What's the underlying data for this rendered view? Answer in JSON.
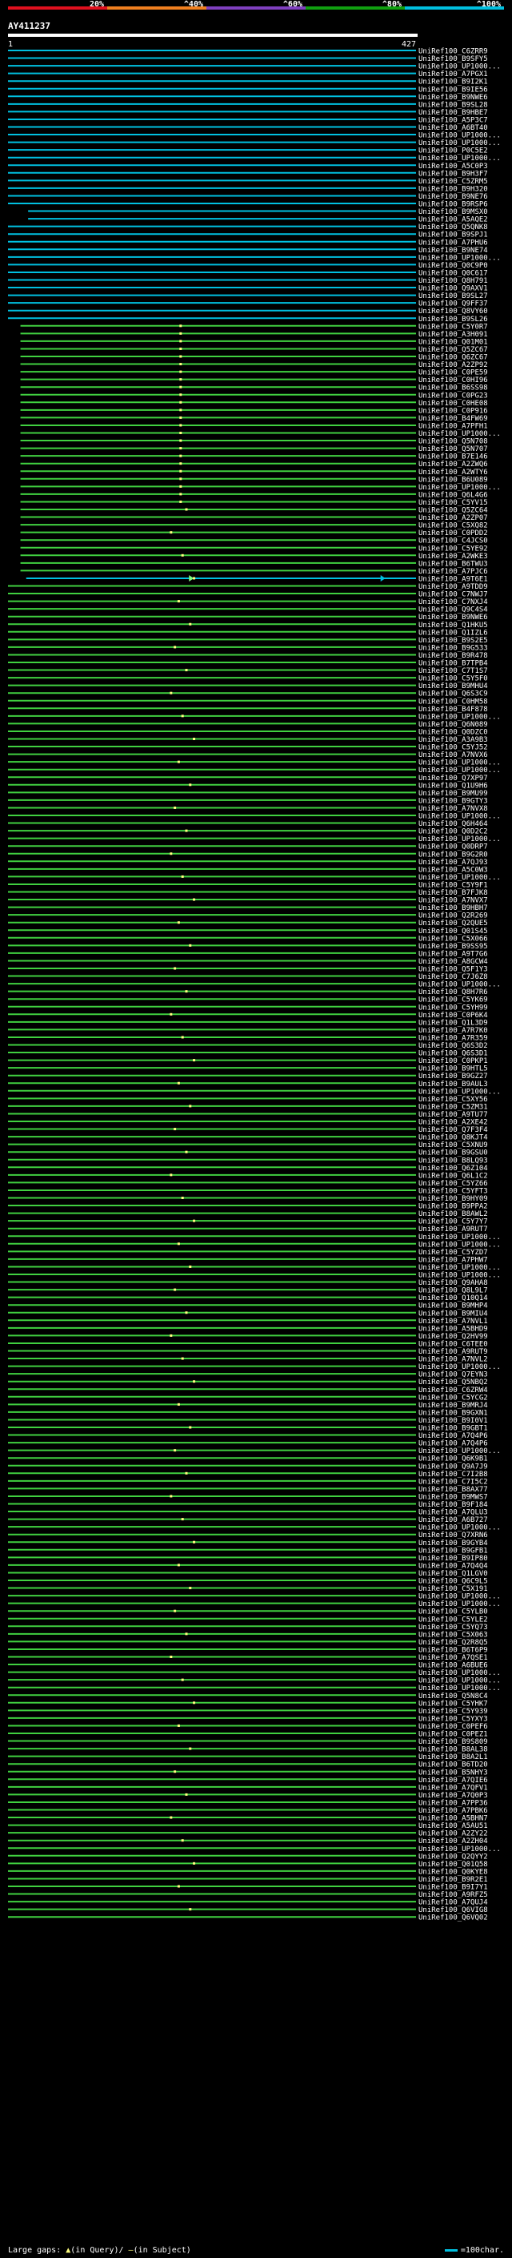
{
  "query": "AY411237",
  "legend": {
    "labels": [
      "20%",
      "^40%",
      "^60%",
      "^80%",
      "^100%"
    ],
    "colors": [
      "#e0101e",
      "#f08020",
      "#8040c0",
      "#10a010",
      "#00c0e0"
    ]
  },
  "footer": {
    "left_prefix": "Large gaps: ",
    "left_middle": "(in Query)/ ",
    "left_suffix": "(in Subject)",
    "right_text": "=100char."
  },
  "chart_data": {
    "type": "alignment-overview",
    "query_length": 427,
    "ruler": {
      "start": 1,
      "end": 427
    },
    "identity_colors": {
      "lt20": "#e0101e",
      "20_40": "#f08020",
      "40_60": "#c020c0",
      "60_80": "#40d040",
      "80_100": "#00c0e0"
    },
    "subjects": [
      "UniRef100_C6ZRR9",
      "UniRef100_B9SFY5",
      "UniRef100_UP1000...",
      "UniRef100_A7PGX1",
      "UniRef100_B9I2K1",
      "UniRef100_B9IE56",
      "UniRef100_B9NWE6",
      "UniRef100_B9SL28",
      "UniRef100_B9HBE7",
      "UniRef100_A5P3C7",
      "UniRef100_A6BT40",
      "UniRef100_UP1000...",
      "UniRef100_UP1000...",
      "UniRef100_P0C5E2",
      "UniRef100_UP1000...",
      "UniRef100_A5C0P3",
      "UniRef100_B9H3F7",
      "UniRef100_C5ZRM5",
      "UniRef100_B9H320",
      "UniRef100_B9NE76",
      "UniRef100_B9RSP6",
      "UniRef100_B9MSX0",
      "UniRef100_A5AQE2",
      "UniRef100_Q5QNK8",
      "UniRef100_B9SPJ1",
      "UniRef100_A7PHU6",
      "UniRef100_B9NE74",
      "UniRef100_UP1000...",
      "UniRef100_Q0C9P0",
      "UniRef100_Q0C617",
      "UniRef100_Q8H791",
      "UniRef100_Q9AXV1",
      "UniRef100_B9SL27",
      "UniRef100_Q9FF37",
      "UniRef100_Q8VY60",
      "UniRef100_B9SL26",
      "UniRef100_C5Y0R7",
      "UniRef100_A3H091",
      "UniRef100_Q01M01",
      "UniRef100_Q5ZC67",
      "UniRef100_Q6ZC67",
      "UniRef100_A2ZP92",
      "UniRef100_C0PE59",
      "UniRef100_C0HI96",
      "UniRef100_B6SS98",
      "UniRef100_C0PG23",
      "UniRef100_C0HE08",
      "UniRef100_C0P916",
      "UniRef100_B4FW69",
      "UniRef100_A7PFH1",
      "UniRef100_UP1000...",
      "UniRef100_Q5N708",
      "UniRef100_Q5N707",
      "UniRef100_B7E146",
      "UniRef100_A2ZWQ6",
      "UniRef100_A2WTY6",
      "UniRef100_B6U089",
      "UniRef100_UP1000...",
      "UniRef100_Q6L4G6",
      "UniRef100_C5YV15",
      "UniRef100_Q5ZC64",
      "UniRef100_A2ZP07",
      "UniRef100_C5XQ82",
      "UniRef100_C0PDD2",
      "UniRef100_C4JCS0",
      "UniRef100_C5YE92",
      "UniRef100_A2WKE3",
      "UniRef100_B6TWU3",
      "UniRef100_A7PJC6",
      "UniRef100_A9T6E1",
      "UniRef100_A9TDD9",
      "UniRef100_C7NWJ7",
      "UniRef100_C7NXJ4",
      "UniRef100_Q9C4S4",
      "UniRef100_B9NWE6",
      "UniRef100_Q1HKU5",
      "UniRef100_Q1IZL6",
      "UniRef100_B9S2E5",
      "UniRef100_B9G533",
      "UniRef100_B9R478",
      "UniRef100_B7TPB4",
      "UniRef100_C7T1S7",
      "UniRef100_C5Y5F0",
      "UniRef100_B9MHU4",
      "UniRef100_Q6S3C9",
      "UniRef100_C0HM58",
      "UniRef100_B4F878",
      "UniRef100_UP1000...",
      "UniRef100_Q6N089",
      "UniRef100_Q0DZC0",
      "UniRef100_A3A9B3",
      "UniRef100_C5YJ52",
      "UniRef100_A7NVX6",
      "UniRef100_UP1000...",
      "UniRef100_UP1000...",
      "UniRef100_Q7XP97",
      "UniRef100_Q1U9H6",
      "UniRef100_B9MU99",
      "UniRef100_B9GTY3",
      "UniRef100_A7NVX8",
      "UniRef100_UP1000...",
      "UniRef100_Q6H464",
      "UniRef100_Q0D2C2",
      "UniRef100_UP1000...",
      "UniRef100_Q0DRP7",
      "UniRef100_B9G2R0",
      "UniRef100_A7QJ93",
      "UniRef100_A5C0W3",
      "UniRef100_UP1000...",
      "UniRef100_C5Y9F1",
      "UniRef100_B7FJK8",
      "UniRef100_A7NVX7",
      "UniRef100_B9HBH7",
      "UniRef100_Q2R269",
      "UniRef100_Q2QUE5",
      "UniRef100_Q01S45",
      "UniRef100_C5X066",
      "UniRef100_B9SS95",
      "UniRef100_A9T7G6",
      "UniRef100_A8GCW4",
      "UniRef100_Q5F1Y3",
      "UniRef100_C7J6Z8",
      "UniRef100_UP1000...",
      "UniRef100_Q8H7R6",
      "UniRef100_C5YK69",
      "UniRef100_C5YH99",
      "UniRef100_C0P6K4",
      "UniRef100_Q1L3D9",
      "UniRef100_A7R7K0",
      "UniRef100_A7R359",
      "UniRef100_Q6S3D2",
      "UniRef100_Q6S3D1",
      "UniRef100_C0PKP1",
      "UniRef100_B9HTL5",
      "UniRef100_B9GZ27",
      "UniRef100_B9AUL3",
      "UniRef100_UP1000...",
      "UniRef100_C5XY56",
      "UniRef100_C5ZM31",
      "UniRef100_A9TU77",
      "UniRef100_A2XE42",
      "UniRef100_Q7F3F4",
      "UniRef100_Q8KJT4",
      "UniRef100_C5XNU9",
      "UniRef100_B9GSU0",
      "UniRef100_B8LQ93",
      "UniRef100_Q6Z104",
      "UniRef100_Q6L1C2",
      "UniRef100_C5YZ66",
      "UniRef100_C5YFT3",
      "UniRef100_B9HY09",
      "UniRef100_B9PPA2",
      "UniRef100_B8AWL2",
      "UniRef100_C5Y7Y7",
      "UniRef100_A9RUT7",
      "UniRef100_UP1000...",
      "UniRef100_UP1000...",
      "UniRef100_C5YZD7",
      "UniRef100_A7PHW7",
      "UniRef100_UP1000...",
      "UniRef100_UP1000...",
      "UniRef100_Q9AHA8",
      "UniRef100_Q8L9L7",
      "UniRef100_Q10Q14",
      "UniRef100_B9MHP4",
      "UniRef100_B9MIU4",
      "UniRef100_A7NVL1",
      "UniRef100_A5BHD9",
      "UniRef100_Q2HV99",
      "UniRef100_C6TEE0",
      "UniRef100_A9RUT9",
      "UniRef100_A7NVL2",
      "UniRef100_UP1000...",
      "UniRef100_Q7EYN3",
      "UniRef100_Q5NBQ2",
      "UniRef100_C6ZRW4",
      "UniRef100_C5YCG2",
      "UniRef100_B9MRJ4",
      "UniRef100_B9GXN1",
      "UniRef100_B9I0V1",
      "UniRef100_B9GBT1",
      "UniRef100_A7Q4P6",
      "UniRef100_A7Q4P6",
      "UniRef100_UP1000...",
      "UniRef100_Q6K9B1",
      "UniRef100_Q9A7J9",
      "UniRef100_C7I2B8",
      "UniRef100_C7I5C2",
      "UniRef100_B8AX77",
      "UniRef100_B9MWS7",
      "UniRef100_B9F184",
      "UniRef100_A7QLU3",
      "UniRef100_A6B727",
      "UniRef100_UP1000...",
      "UniRef100_Q7XRN6",
      "UniRef100_B9GYB4",
      "UniRef100_B9GFB1",
      "UniRef100_B9IP80",
      "UniRef100_A7Q4Q4",
      "UniRef100_Q1LGV0",
      "UniRef100_Q6C9L5",
      "UniRef100_C5X191",
      "UniRef100_UP1000...",
      "UniRef100_UP1000...",
      "UniRef100_C5YLB0",
      "UniRef100_C5YLE2",
      "UniRef100_C5YQ73",
      "UniRef100_C5X063",
      "UniRef100_Q2R8Q5",
      "UniRef100_B6T6P9",
      "UniRef100_A7QSE1",
      "UniRef100_A6BUE6",
      "UniRef100_UP1000...",
      "UniRef100_UP1000...",
      "UniRef100_UP1000...",
      "UniRef100_Q5N8C4",
      "UniRef100_C5YHK7",
      "UniRef100_C5Y939",
      "UniRef100_C5YXY3",
      "UniRef100_C0PEF6",
      "UniRef100_C0PEZ1",
      "UniRef100_B9S809",
      "UniRef100_B8AL38",
      "UniRef100_B8A2L1",
      "UniRef100_B6TD20",
      "UniRef100_B5NHY3",
      "UniRef100_A7QIE6",
      "UniRef100_A7QFV1",
      "UniRef100_A7Q0P3",
      "UniRef100_A7PP36",
      "UniRef100_A7PBK6",
      "UniRef100_A5BHN7",
      "UniRef100_A5AU51",
      "UniRef100_A2ZY22",
      "UniRef100_A2ZH04",
      "UniRef100_UP1000...",
      "UniRef100_Q2QYY2",
      "UniRef100_Q01Q58",
      "UniRef100_Q0KYE8",
      "UniRef100_B9R2E1",
      "UniRef100_B9I7Y1",
      "UniRef100_A9RFZ5",
      "UniRef100_A7QUJ4",
      "UniRef100_Q6VIG8",
      "UniRef100_Q6VQ02"
    ]
  }
}
